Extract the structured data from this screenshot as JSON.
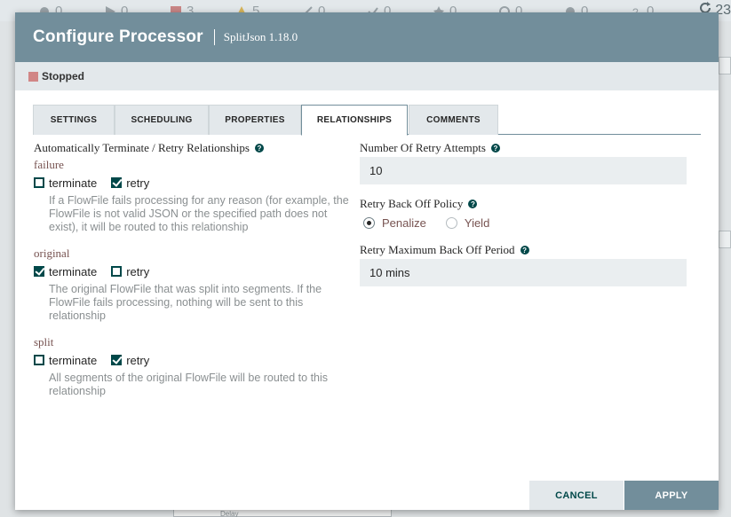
{
  "toolbar": {
    "stats": [
      {
        "icon": "transmitting-icon",
        "value": "0"
      },
      {
        "icon": "running-icon",
        "value": "0"
      },
      {
        "icon": "stopped-icon",
        "value": "3"
      },
      {
        "icon": "invalid-icon",
        "value": "5"
      },
      {
        "icon": "disabled-icon",
        "value": "0"
      },
      {
        "icon": "up-to-date-icon",
        "value": "0"
      },
      {
        "icon": "locally-modified-icon",
        "value": "0"
      },
      {
        "icon": "stale-icon",
        "value": "0"
      },
      {
        "icon": "sync-failure-icon",
        "value": "0"
      },
      {
        "icon": "errors-icon",
        "value": "0"
      }
    ],
    "refresh_count": "23"
  },
  "dialog": {
    "title": "Configure Processor",
    "subtitle": "SplitJson 1.18.0",
    "status": "Stopped",
    "status_color": "#d18686",
    "accent_color": "#728e9b",
    "tabs": [
      {
        "label": "SETTINGS"
      },
      {
        "label": "SCHEDULING"
      },
      {
        "label": "PROPERTIES"
      },
      {
        "label": "RELATIONSHIPS",
        "active": true
      },
      {
        "label": "COMMENTS"
      }
    ],
    "relationships": {
      "heading": "Automatically Terminate / Retry Relationships",
      "items": [
        {
          "name": "failure",
          "terminate_label": "terminate",
          "terminate": false,
          "retry_label": "retry",
          "retry": true,
          "description": "If a FlowFile fails processing for any reason (for example, the FlowFile is not valid JSON or the specified path does not exist), it will be routed to this relationship"
        },
        {
          "name": "original",
          "terminate_label": "terminate",
          "terminate": true,
          "retry_label": "retry",
          "retry": false,
          "description": "The original FlowFile that was split into segments. If the FlowFile fails processing, nothing will be sent to this relationship"
        },
        {
          "name": "split",
          "terminate_label": "terminate",
          "terminate": false,
          "retry_label": "retry",
          "retry": true,
          "description": "All segments of the original FlowFile will be routed to this relationship"
        }
      ]
    },
    "retry": {
      "attempts_label": "Number Of Retry Attempts",
      "attempts_value": "10",
      "policy_label": "Retry Back Off Policy",
      "policy_options": [
        {
          "label": "Penalize",
          "selected": true
        },
        {
          "label": "Yield",
          "selected": false
        }
      ],
      "max_period_label": "Retry Maximum Back Off Period",
      "max_period_value": "10 mins"
    },
    "buttons": {
      "cancel": "CANCEL",
      "apply": "APPLY"
    }
  },
  "background": {
    "component_label": "Delay"
  }
}
